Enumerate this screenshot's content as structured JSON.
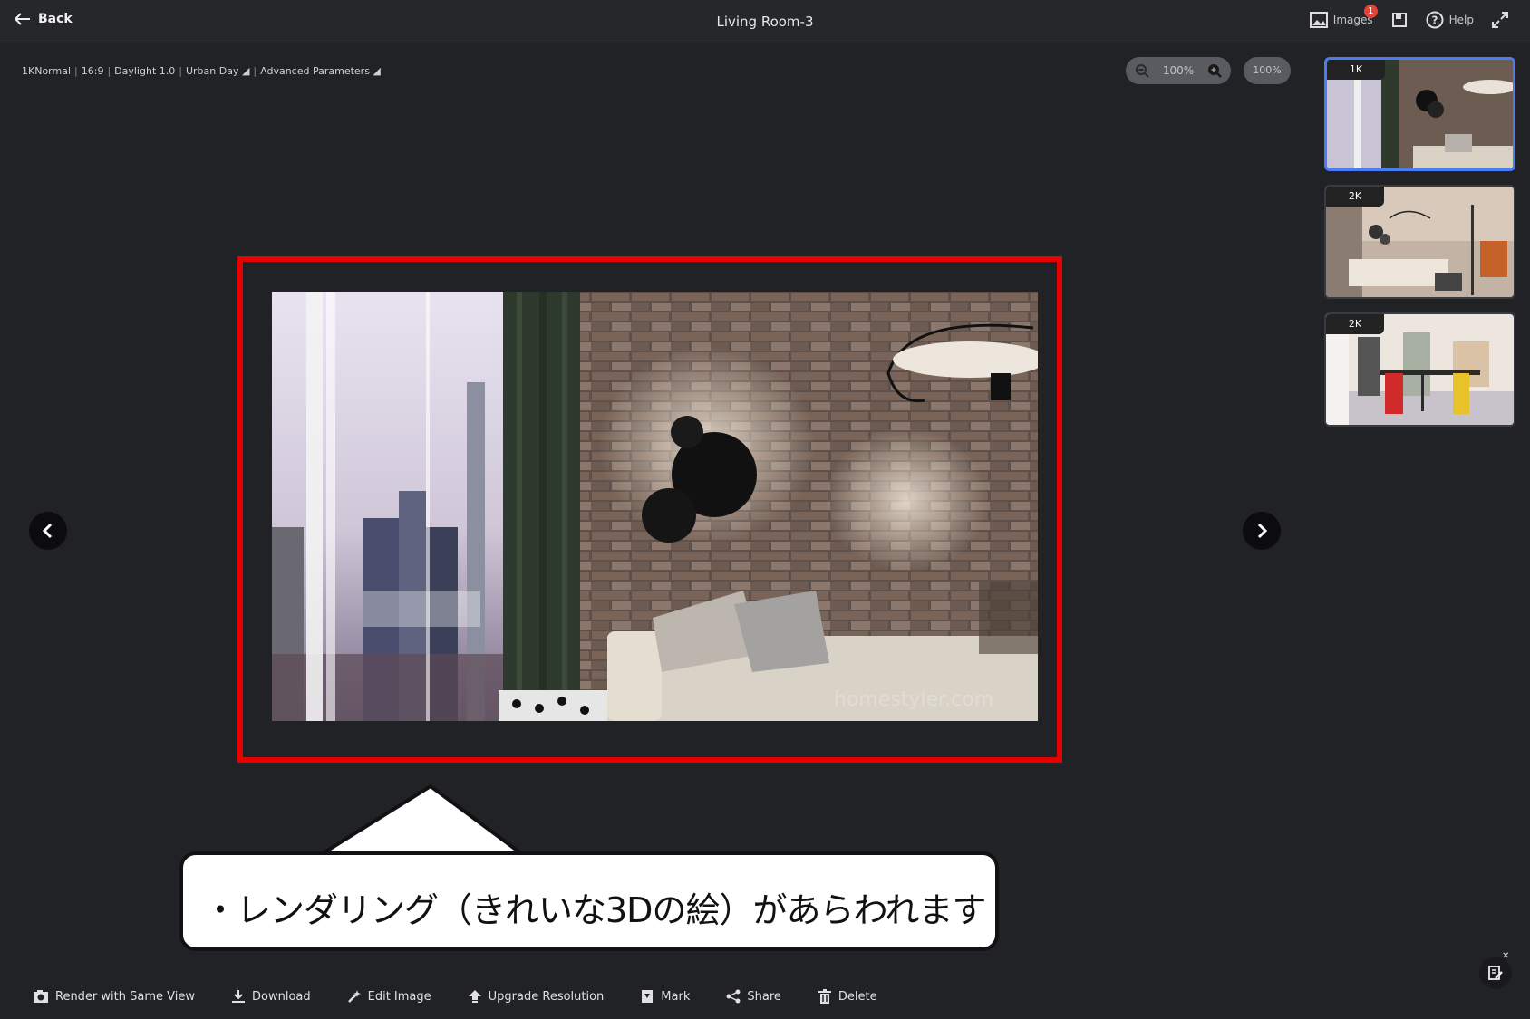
{
  "header": {
    "back_label": "Back",
    "title": "Living Room-3",
    "images_label": "Images",
    "images_badge": "1",
    "help_label": "Help"
  },
  "params": {
    "quality": "1KNormal",
    "ratio": "16:9",
    "daylight": "Daylight 1.0",
    "environment": "Urban Day ◢",
    "advanced": "Advanced Parameters ◢"
  },
  "zoom": {
    "value": "100%",
    "reset_label": "100%"
  },
  "thumbnails": [
    {
      "label": "1K",
      "active": true
    },
    {
      "label": "2K",
      "active": false
    },
    {
      "label": "2K",
      "active": false
    }
  ],
  "render": {
    "watermark": "homestyler.com"
  },
  "callout": {
    "text": "・レンダリング（きれいな3Dの絵）があらわれます"
  },
  "actions": {
    "render_same_view": "Render with Same View",
    "download": "Download",
    "edit_image": "Edit Image",
    "upgrade_resolution": "Upgrade Resolution",
    "mark": "Mark",
    "share": "Share",
    "delete": "Delete"
  },
  "colors": {
    "accent": "#4b7cf5",
    "highlight_frame": "#e60000",
    "badge": "#e8413a"
  }
}
